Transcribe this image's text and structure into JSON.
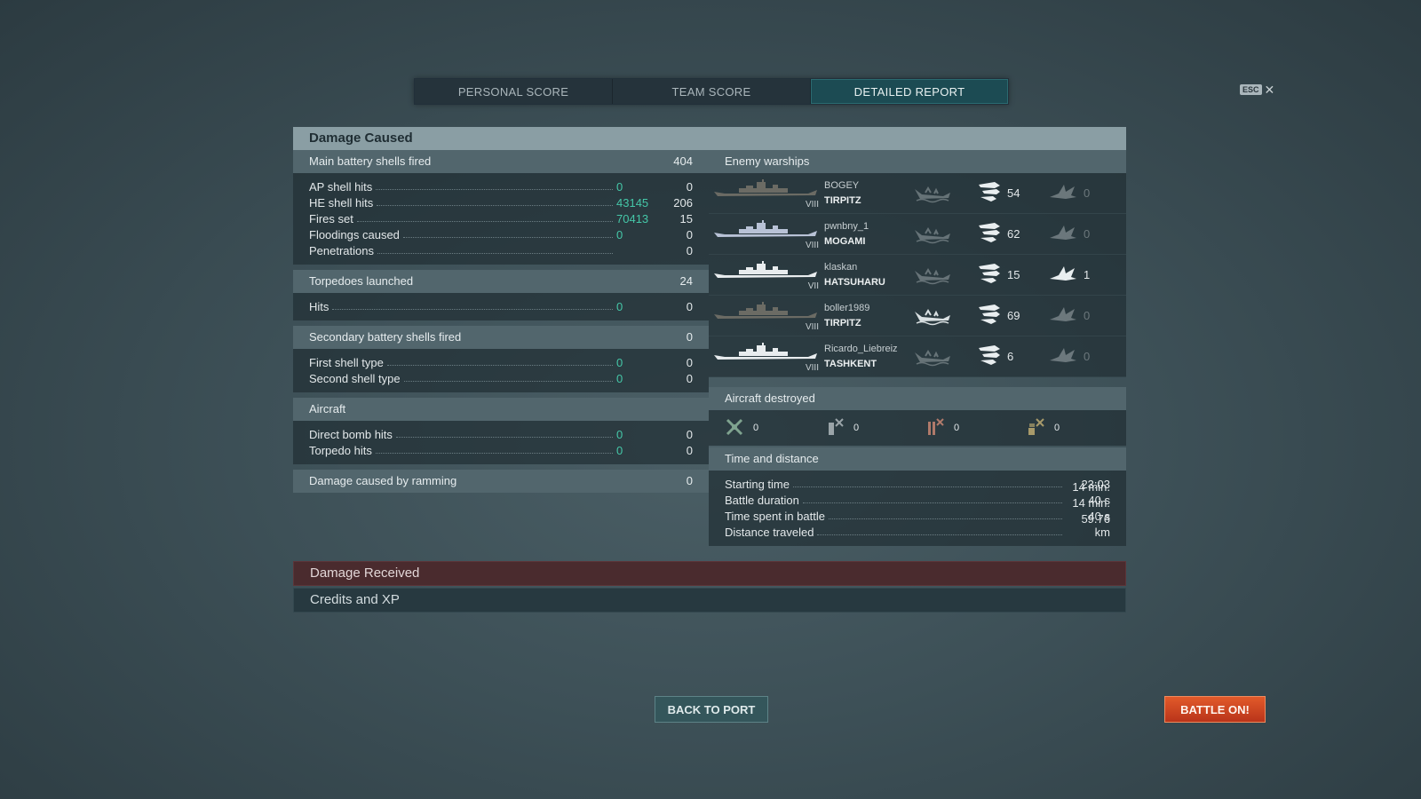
{
  "tabs": [
    {
      "label": "PERSONAL SCORE",
      "active": false
    },
    {
      "label": "TEAM SCORE",
      "active": false
    },
    {
      "label": "DETAILED REPORT",
      "active": true
    }
  ],
  "esc": {
    "key": "ESC",
    "close": "✕"
  },
  "damage_caused": {
    "title": "Damage Caused",
    "main_battery": {
      "label": "Main battery shells fired",
      "value": "404",
      "rows": [
        {
          "label": "AP shell hits",
          "damage": "0",
          "value": "0"
        },
        {
          "label": "HE shell hits",
          "damage": "43145",
          "value": "206"
        },
        {
          "label": "Fires set",
          "damage": "70413",
          "value": "15"
        },
        {
          "label": "Floodings caused",
          "damage": "0",
          "value": "0"
        },
        {
          "label": "Penetrations",
          "damage": "",
          "value": "0"
        }
      ]
    },
    "torpedoes": {
      "label": "Torpedoes launched",
      "value": "24",
      "rows": [
        {
          "label": "Hits",
          "damage": "0",
          "value": "0"
        }
      ]
    },
    "secondary": {
      "label": "Secondary battery shells fired",
      "value": "0",
      "rows": [
        {
          "label": "First shell type",
          "damage": "0",
          "value": "0"
        },
        {
          "label": "Second shell type",
          "damage": "0",
          "value": "0"
        }
      ]
    },
    "aircraft": {
      "label": "Aircraft",
      "value": "",
      "rows": [
        {
          "label": "Direct bomb hits",
          "damage": "0",
          "value": "0"
        },
        {
          "label": "Torpedo hits",
          "damage": "0",
          "value": "0"
        }
      ]
    },
    "ramming": {
      "label": "Damage caused by ramming",
      "value": "0"
    }
  },
  "enemy_warships": {
    "title": "Enemy warships",
    "ships": [
      {
        "player": "BOGEY",
        "name": "TIRPITZ",
        "tier": "VIII",
        "hits": "54",
        "fires": "0",
        "sunk": false,
        "hull": "#6b6b64"
      },
      {
        "player": "pwnbny_1",
        "name": "MOGAMI",
        "tier": "VIII",
        "hits": "62",
        "fires": "0",
        "sunk": false,
        "hull": "#b8c2d6"
      },
      {
        "player": "klaskan",
        "name": "HATSUHARU",
        "tier": "VII",
        "hits": "15",
        "fires": "1",
        "sunk": false,
        "hull": "#e8ecee"
      },
      {
        "player": "boller1989",
        "name": "TIRPITZ",
        "tier": "VIII",
        "hits": "69",
        "fires": "0",
        "sunk": true,
        "hull": "#6b6b64"
      },
      {
        "player": "Ricardo_Liebreiz",
        "name": "TASHKENT",
        "tier": "VIII",
        "hits": "6",
        "fires": "0",
        "sunk": false,
        "hull": "#e8ecee"
      }
    ]
  },
  "aircraft_destroyed": {
    "title": "Aircraft destroyed",
    "items": [
      {
        "icon": "fighter-plane-icon",
        "value": "0"
      },
      {
        "icon": "fighter-ammo-icon",
        "value": "0"
      },
      {
        "icon": "torpedo-bomber-icon",
        "value": "0"
      },
      {
        "icon": "dive-bomber-icon",
        "value": "0"
      }
    ]
  },
  "time_distance": {
    "title": "Time and distance",
    "rows": [
      {
        "label": "Starting time",
        "value": "23:03"
      },
      {
        "label": "Battle duration",
        "value": "14 min. 40 s"
      },
      {
        "label": "Time spent in battle",
        "value": "14 min. 40 s"
      },
      {
        "label": "Distance traveled",
        "value": "59.76 km"
      }
    ]
  },
  "damage_received": {
    "label": "Damage Received"
  },
  "credits_xp": {
    "label": "Credits and XP"
  },
  "buttons": {
    "back": "BACK TO PORT",
    "battle": "BATTLE ON!"
  }
}
